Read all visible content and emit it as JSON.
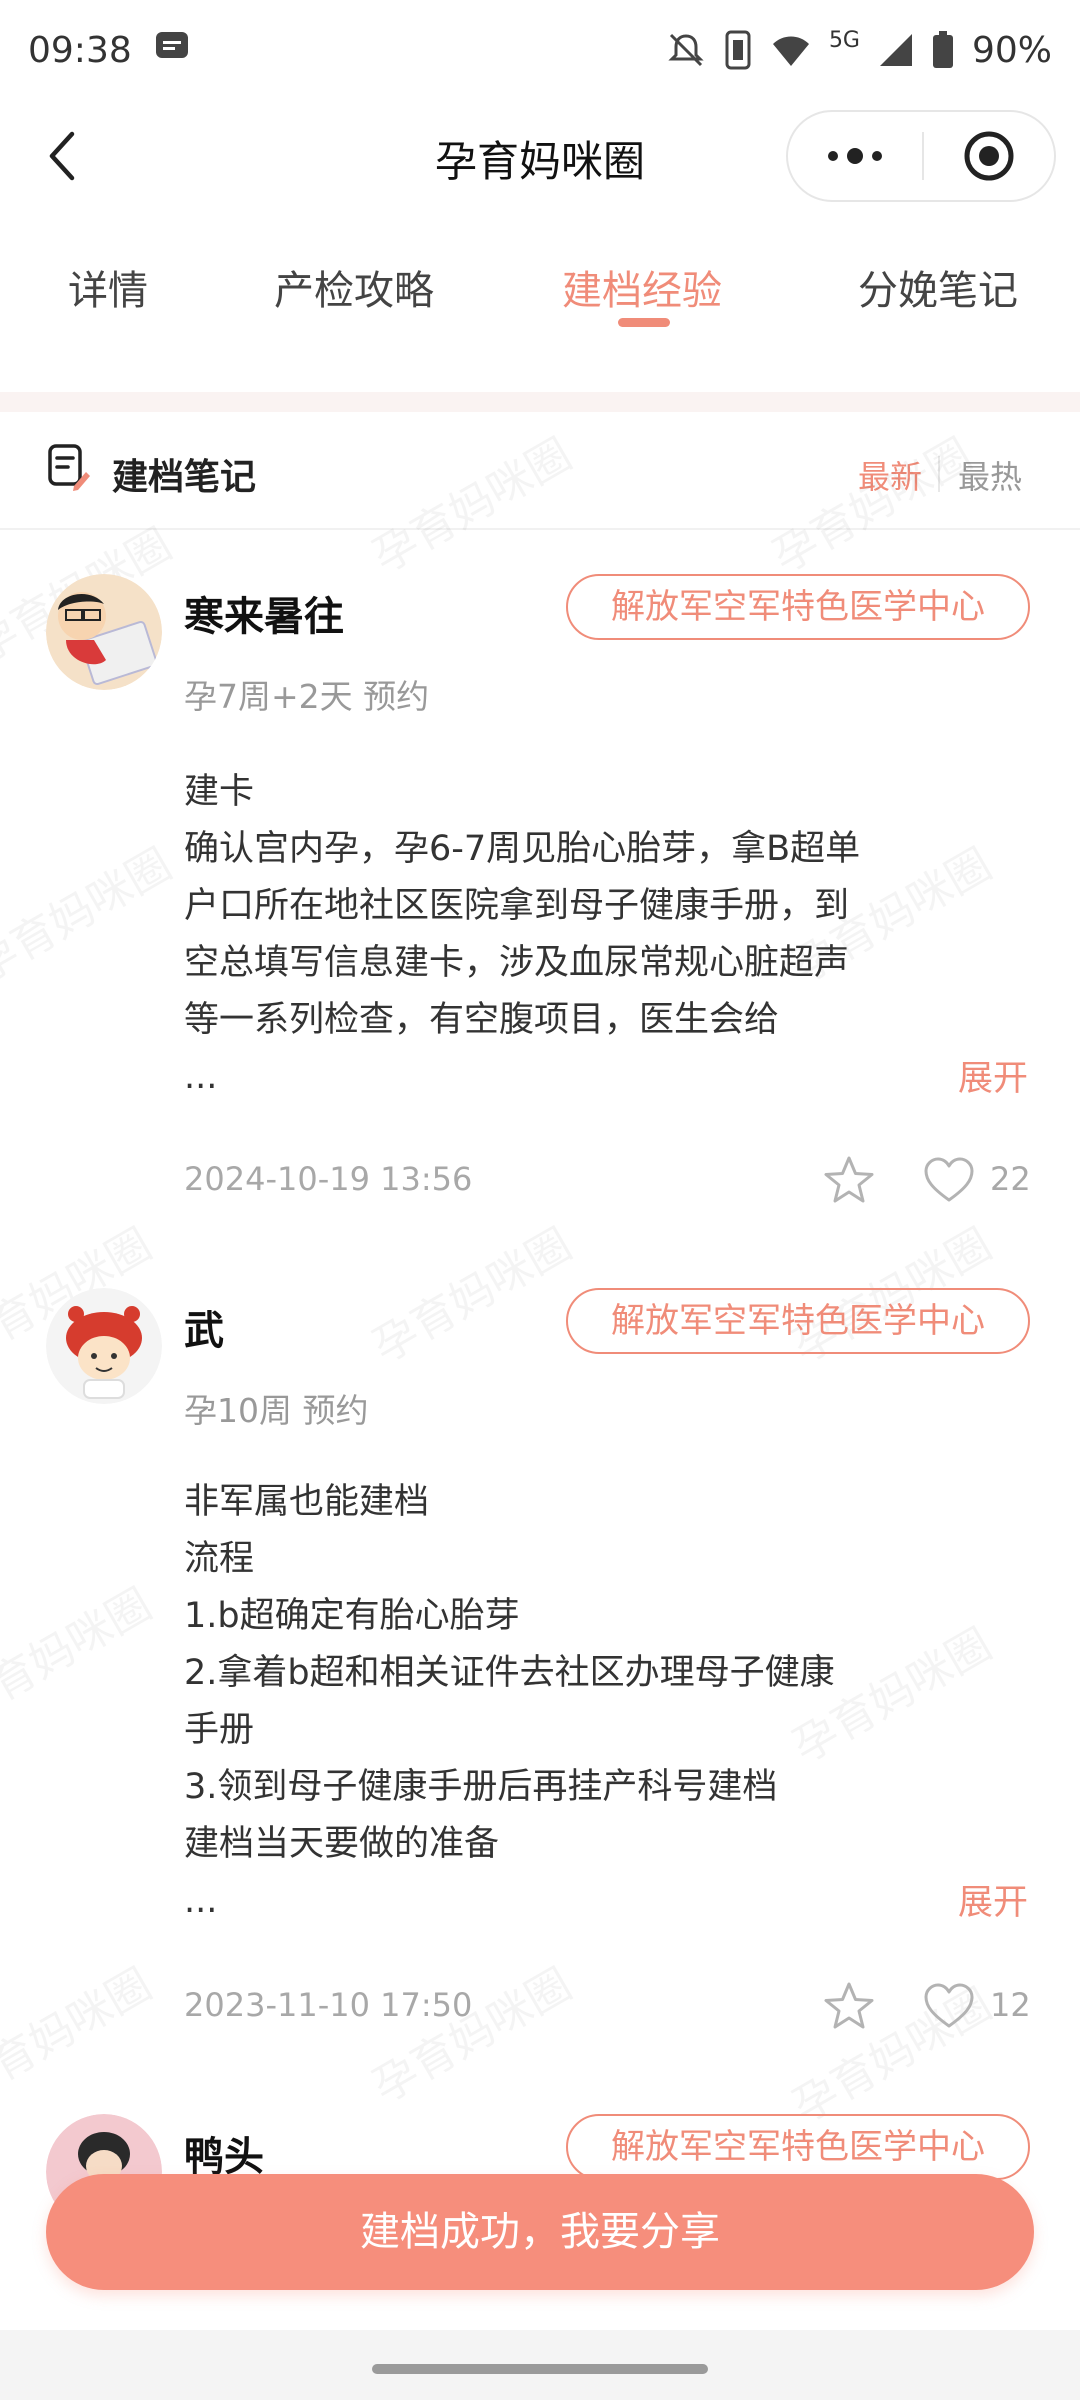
{
  "status_bar": {
    "time": "09:38",
    "battery": "90%",
    "network": "5G",
    "icons": [
      "message-icon",
      "mute-icon",
      "vibrate-icon",
      "wifi-icon",
      "signal-icon",
      "battery-icon"
    ]
  },
  "nav": {
    "title": "孕育妈咪圈"
  },
  "tabs": [
    {
      "label": "详情"
    },
    {
      "label": "产检攻略"
    },
    {
      "label": "建档经验"
    },
    {
      "label": "分娩笔记"
    }
  ],
  "active_tab_index": 2,
  "section": {
    "title": "建档笔记",
    "sort_newest": "最新",
    "sort_hottest": "最热",
    "watermark": "孕育妈咪圈"
  },
  "posts": [
    {
      "author": "寒来暑往",
      "hospital": "解放军空军特色医学中心",
      "meta": "孕7周+2天 预约",
      "lines": [
        "建卡",
        "确认宫内孕，孕6-7周见胎心胎芽，拿B超单",
        "户口所在地社区医院拿到母子健康手册，到",
        "空总填写信息建卡，涉及血尿常规心脏超声",
        "等一系列检查，有空腹项目，医生会给",
        "..."
      ],
      "expand": "展开",
      "date": "2024-10-19 13:56",
      "likes": "22"
    },
    {
      "author": "武",
      "hospital": "解放军空军特色医学中心",
      "meta": "孕10周 预约",
      "lines": [
        "非军属也能建档",
        "流程",
        "1.b超确定有胎心胎芽",
        "2.拿着b超和相关证件去社区办理母子健康",
        "手册",
        "3.领到母子健康手册后再挂产科号建档",
        "建档当天要做的准备",
        "..."
      ],
      "expand": "展开",
      "date": "2023-11-10 17:50",
      "likes": "12"
    },
    {
      "author": "鸭头",
      "hospital": "解放军空军特色医学中心"
    }
  ],
  "share_button": "建档成功，我要分享",
  "colors": {
    "accent": "#f08c79",
    "button": "#f68e7c",
    "muted": "#a8a8a8"
  }
}
